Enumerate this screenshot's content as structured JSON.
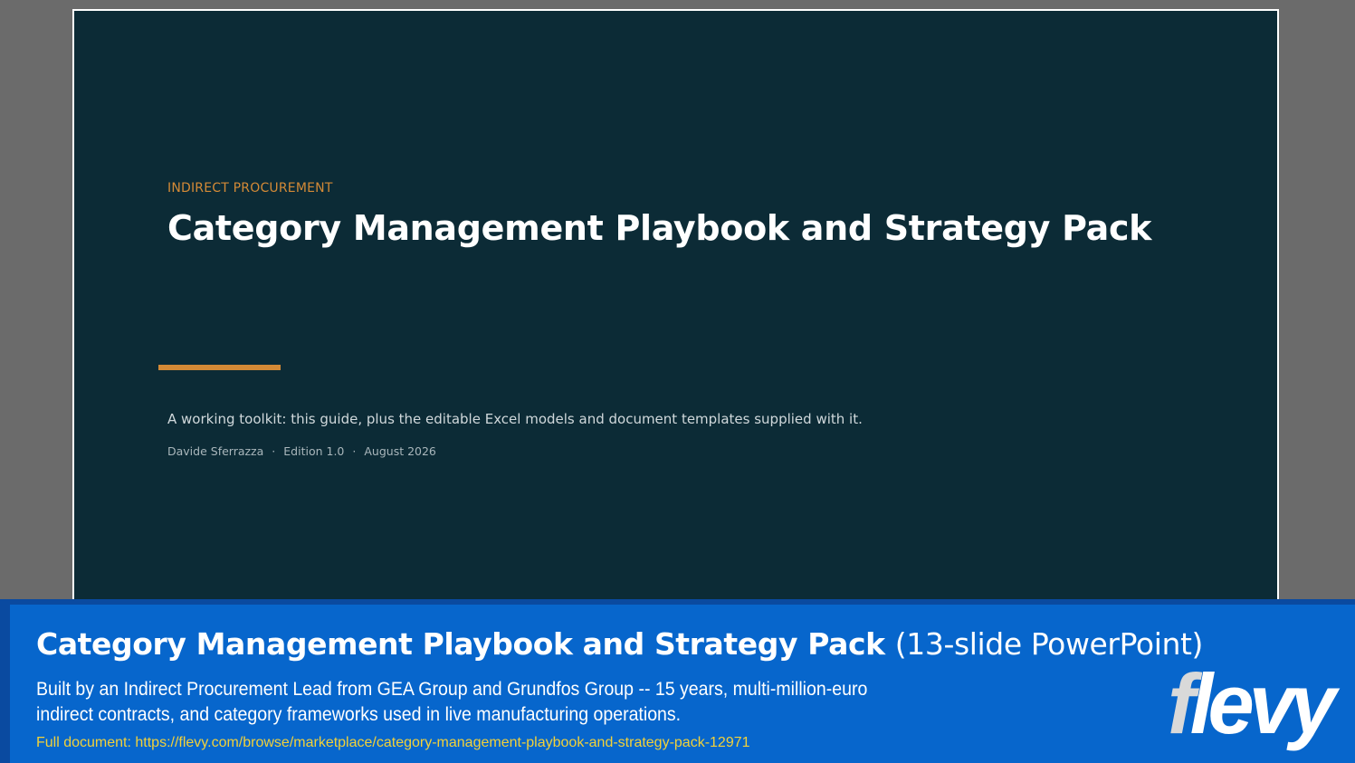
{
  "slide": {
    "eyebrow": "INDIRECT PROCUREMENT",
    "title": "Category Management Playbook and Strategy Pack",
    "subtitle": "A working toolkit: this guide, plus the editable Excel models and document templates supplied with it.",
    "author": "Davide Sferrazza",
    "edition": "Edition 1.0",
    "date": "August 2026",
    "separator": "·",
    "colors": {
      "background": "#0c2b36",
      "accent": "#d48a36",
      "title": "#ffffff"
    }
  },
  "banner": {
    "title": "Category Management Playbook and Strategy Pack",
    "title_suffix": "(13-slide PowerPoint)",
    "description": "Built by an Indirect Procurement Lead from GEA Group and Grundfos Group -- 15 years, multi-million-euro indirect contracts, and category frameworks used in live manufacturing operations.",
    "link": "Full document: https://flevy.com/browse/marketplace/category-management-playbook-and-strategy-pack-12971",
    "logo_text": "flevy",
    "colors": {
      "background": "#0766cc",
      "link": "#f2d13a"
    }
  }
}
